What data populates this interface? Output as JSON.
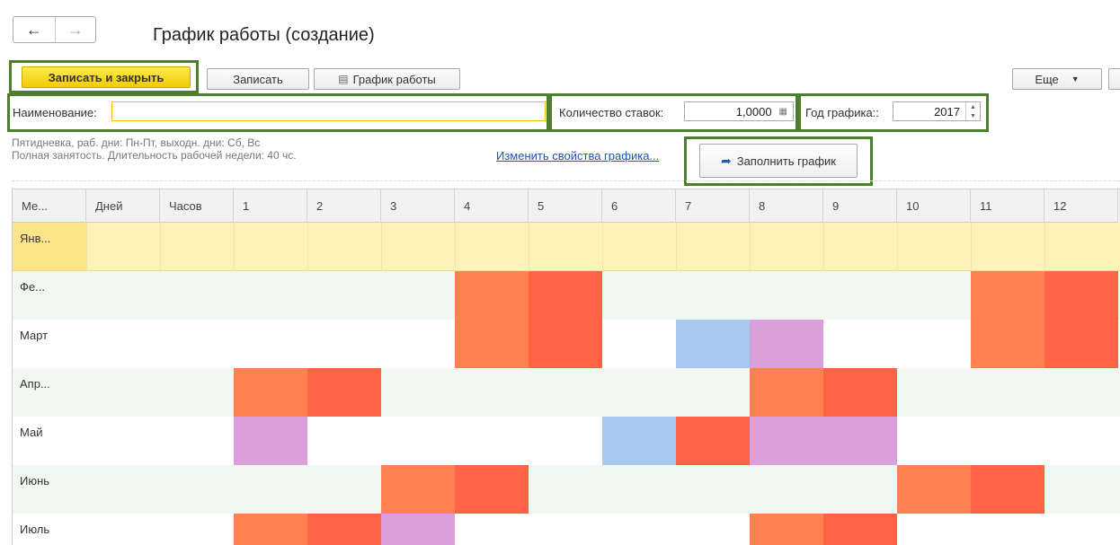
{
  "window": {
    "title": "График работы (создание)"
  },
  "nav": {
    "back_icon": "←",
    "forward_icon": "→"
  },
  "toolbar": {
    "save_close_label": "Записать и закрыть",
    "save_label": "Записать",
    "schedule_label": "График работы",
    "schedule_icon": "printer-icon",
    "more_label": "Еще"
  },
  "fields": {
    "name_label": "Наименование:",
    "name_value": "",
    "rates_label": "Количество ставок:",
    "rates_value": "1,0000",
    "year_label": "Год графика::",
    "year_value": "2017"
  },
  "info": {
    "line1": "Пятидневка, раб. дни: Пн-Пт, выходн. дни: Сб, Вс",
    "line2": "Полная занятость. Длительность рабочей недели: 40 чс.",
    "change_link": "Изменить свойства графика...",
    "fill_button": "Заполнить график"
  },
  "colors": {
    "header_bg": "#f2f2f2",
    "selected_bg": "#fff2b8",
    "selected_cell_bg": "#ffe58a",
    "odd_row_bg": "#ffffff",
    "even_row_bg": "#f1f8f1",
    "holiday_orange": "#ff814f",
    "holiday_red": "#ff6347",
    "holiday_blue": "#a8c8ee",
    "holiday_pink": "#dba0db",
    "frame_green": "#4f7d2f"
  },
  "table": {
    "headers": [
      "Ме...",
      "Дней",
      "Часов",
      "1",
      "2",
      "3",
      "4",
      "5",
      "6",
      "7",
      "8",
      "9",
      "10",
      "11",
      "12"
    ],
    "rows": [
      {
        "month": "Янв...",
        "cells": []
      },
      {
        "month": "Фе...",
        "cells": [
          {
            "day": 4,
            "color": "holiday_orange"
          },
          {
            "day": 5,
            "color": "holiday_red"
          },
          {
            "day": 11,
            "color": "holiday_orange"
          },
          {
            "day": 12,
            "color": "holiday_red"
          }
        ]
      },
      {
        "month": "Март",
        "cells": [
          {
            "day": 4,
            "color": "holiday_orange"
          },
          {
            "day": 5,
            "color": "holiday_red"
          },
          {
            "day": 7,
            "color": "holiday_blue"
          },
          {
            "day": 8,
            "color": "holiday_pink"
          },
          {
            "day": 11,
            "color": "holiday_orange"
          },
          {
            "day": 12,
            "color": "holiday_red"
          }
        ]
      },
      {
        "month": "Апр...",
        "cells": [
          {
            "day": 1,
            "color": "holiday_orange"
          },
          {
            "day": 2,
            "color": "holiday_red"
          },
          {
            "day": 8,
            "color": "holiday_orange"
          },
          {
            "day": 9,
            "color": "holiday_red"
          }
        ]
      },
      {
        "month": "Май",
        "cells": [
          {
            "day": 1,
            "color": "holiday_pink"
          },
          {
            "day": 6,
            "color": "holiday_blue"
          },
          {
            "day": 7,
            "color": "holiday_red"
          },
          {
            "day": 8,
            "color": "holiday_pink"
          },
          {
            "day": 9,
            "color": "holiday_pink"
          }
        ]
      },
      {
        "month": "Июнь",
        "cells": [
          {
            "day": 3,
            "color": "holiday_orange"
          },
          {
            "day": 4,
            "color": "holiday_red"
          },
          {
            "day": 10,
            "color": "holiday_orange"
          },
          {
            "day": 11,
            "color": "holiday_red"
          }
        ]
      },
      {
        "month": "Июль",
        "cells": [
          {
            "day": 1,
            "color": "holiday_orange"
          },
          {
            "day": 2,
            "color": "holiday_red"
          },
          {
            "day": 3,
            "color": "holiday_pink"
          },
          {
            "day": 8,
            "color": "holiday_orange"
          },
          {
            "day": 9,
            "color": "holiday_red"
          }
        ]
      }
    ]
  }
}
